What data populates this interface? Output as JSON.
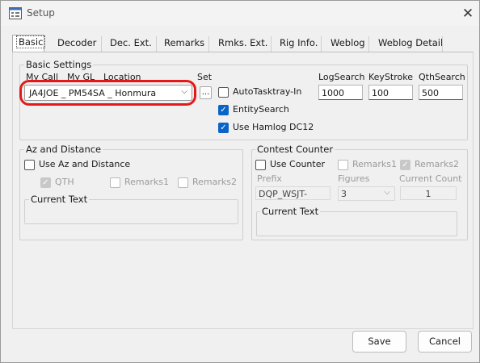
{
  "window": {
    "title": "Setup",
    "close_glyph": "✕",
    "icon": "app-settings-icon"
  },
  "tabs": [
    {
      "label": "Basic",
      "active": true
    },
    {
      "label": "Decoder"
    },
    {
      "label": "Dec. Ext."
    },
    {
      "label": "Remarks"
    },
    {
      "label": "Rmks. Ext."
    },
    {
      "label": "Rig Info."
    },
    {
      "label": "Weblog"
    },
    {
      "label": "Weblog Detail"
    }
  ],
  "basic": {
    "title": "Basic Settings",
    "col_mycall": "My Call",
    "col_mygl": "My GL",
    "col_location": "Location",
    "location_value": "JA4JOE _ PM54SA _ Honmura",
    "set_label": "Set",
    "set_button": "...",
    "autotasktray": {
      "label": "AutoTasktray-In",
      "checked": false
    },
    "entitysearch": {
      "label": "EntitySearch",
      "checked": true
    },
    "hamlog": {
      "label": "Use Hamlog DC12",
      "checked": true
    },
    "logsearch": {
      "label": "LogSearch",
      "value": "1000"
    },
    "keystroke": {
      "label": "KeyStroke",
      "value": "100"
    },
    "qthsearch": {
      "label": "QthSearch",
      "value": "500"
    }
  },
  "az": {
    "title": "Az and Distance",
    "use": {
      "label": "Use Az and Distance",
      "checked": false
    },
    "qth": {
      "label": "QTH",
      "checked": true
    },
    "remarks1": {
      "label": "Remarks1",
      "checked": false
    },
    "remarks2": {
      "label": "Remarks2",
      "checked": false
    },
    "current_text_label": "Current Text"
  },
  "contest": {
    "title": "Contest Counter",
    "use": {
      "label": "Use Counter",
      "checked": false
    },
    "remarks1": {
      "label": "Remarks1",
      "checked": false
    },
    "remarks2": {
      "label": "Remarks2",
      "checked": true
    },
    "prefix_label": "Prefix",
    "prefix_value": "DQP_WSJT-",
    "figures_label": "Figures",
    "figures_value": "3",
    "count_label": "Current Count",
    "count_value": "1",
    "current_text_label": "Current Text"
  },
  "buttons": {
    "save": "Save",
    "cancel": "Cancel"
  },
  "colors": {
    "highlight": "#e41a1a",
    "accent": "#0a64c8"
  }
}
